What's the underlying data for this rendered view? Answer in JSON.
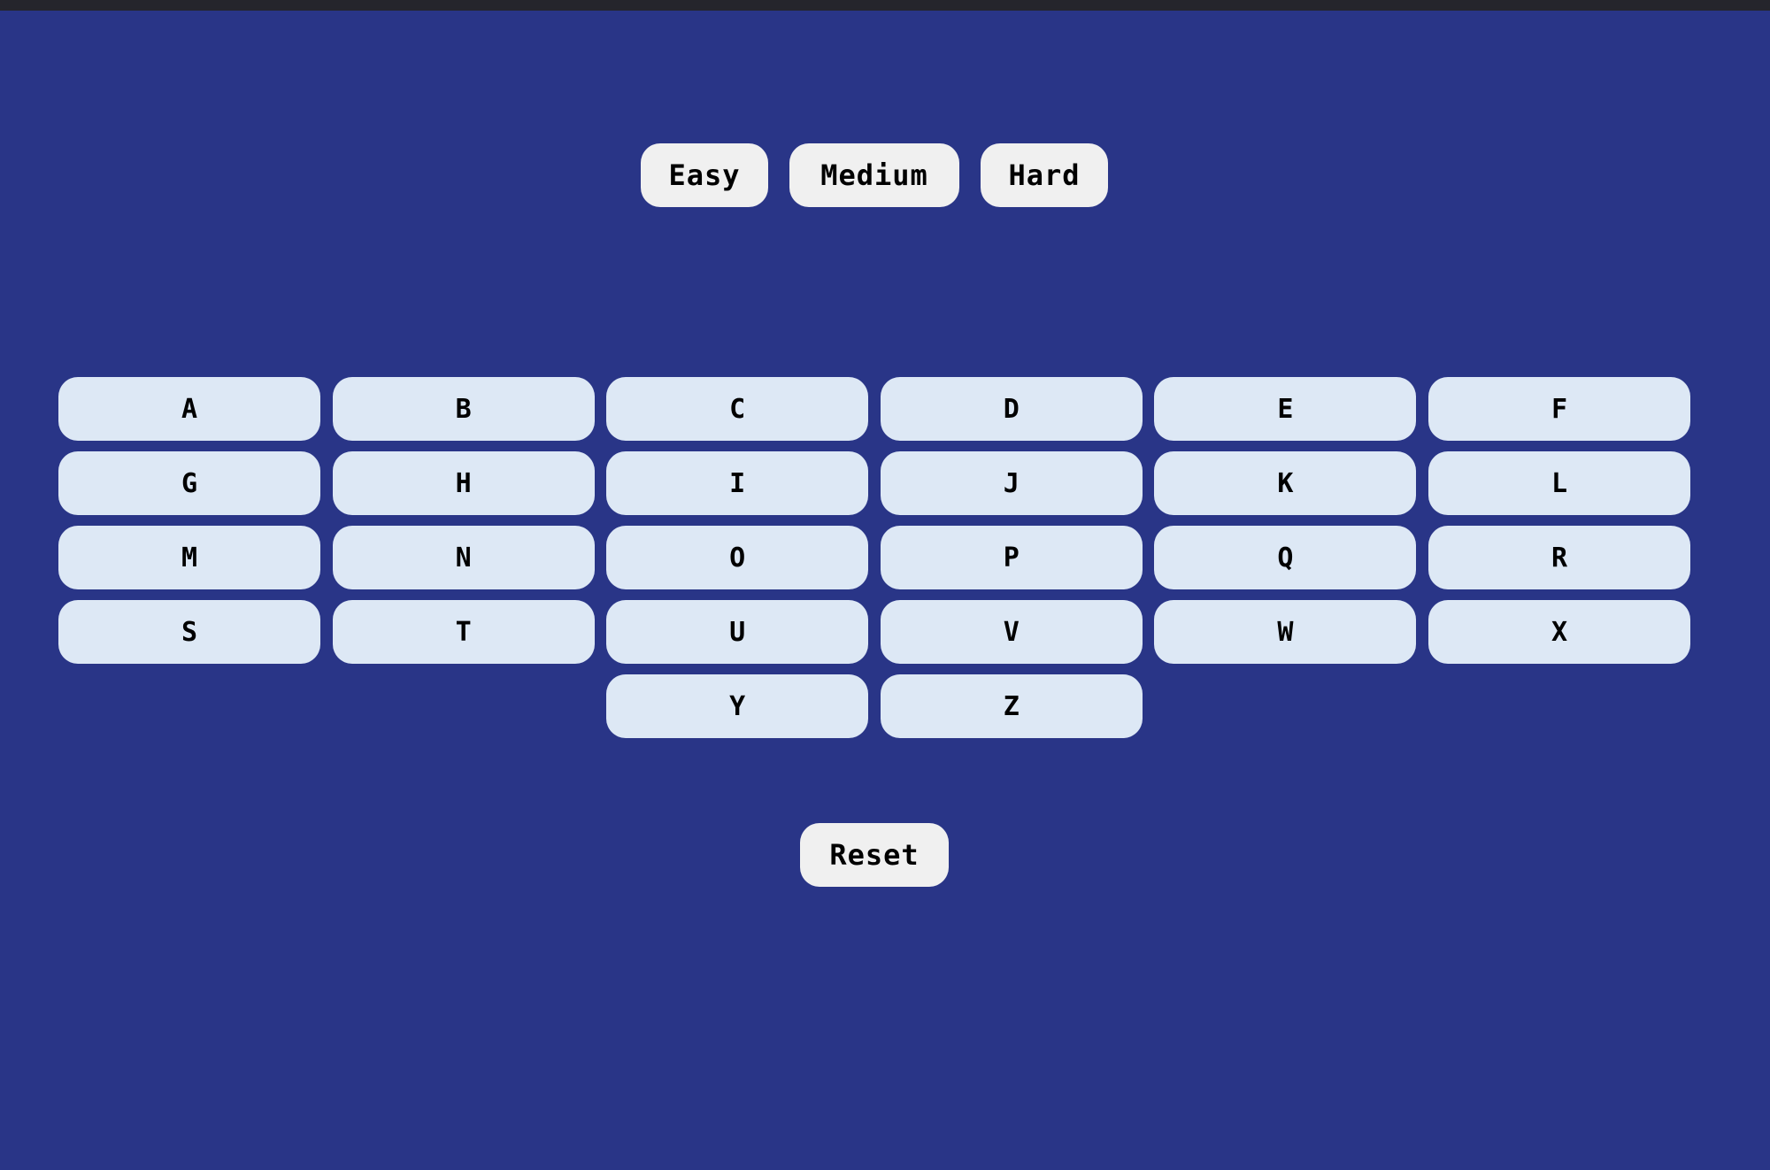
{
  "difficulty": {
    "easy_label": "Easy",
    "medium_label": "Medium",
    "hard_label": "Hard"
  },
  "letters": [
    "A",
    "B",
    "C",
    "D",
    "E",
    "F",
    "G",
    "H",
    "I",
    "J",
    "K",
    "L",
    "M",
    "N",
    "O",
    "P",
    "Q",
    "R",
    "S",
    "T",
    "U",
    "V",
    "W",
    "X",
    "Y",
    "Z"
  ],
  "reset_label": "Reset",
  "colors": {
    "background": "#293587",
    "top_bar": "#25252c",
    "difficulty_button": "#f0f0f0",
    "letter_button": "#dde8f5",
    "text": "#000000"
  }
}
